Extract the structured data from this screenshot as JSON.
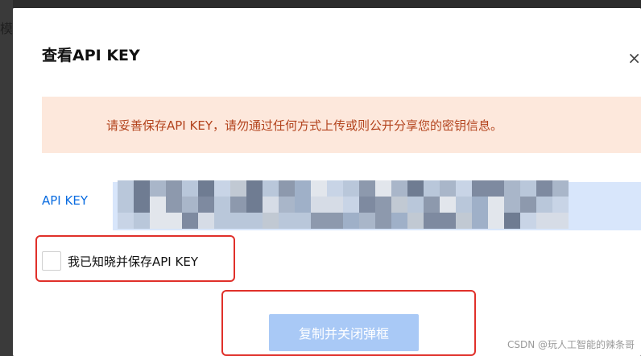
{
  "backdrop": {
    "partial_char": "模"
  },
  "dialog": {
    "title": "查看API KEY",
    "close_glyph": "×",
    "warning_text": "请妥善保存API KEY，请勿通过任何方式上传或则公开分享您的密钥信息。",
    "key_label": "API KEY",
    "ack_checkbox_label": "我已知晓并保存API KEY",
    "ack_checked": false,
    "primary_button_label": "复制并关闭弹框"
  },
  "watermark": "CSDN @玩人工智能的辣条哥",
  "colors": {
    "warning_bg": "#fde8dc",
    "warning_text": "#b3431d",
    "link_blue": "#0a6ce0",
    "button_disabled": "#a9c9f6",
    "annotation_red": "#e0302a"
  }
}
